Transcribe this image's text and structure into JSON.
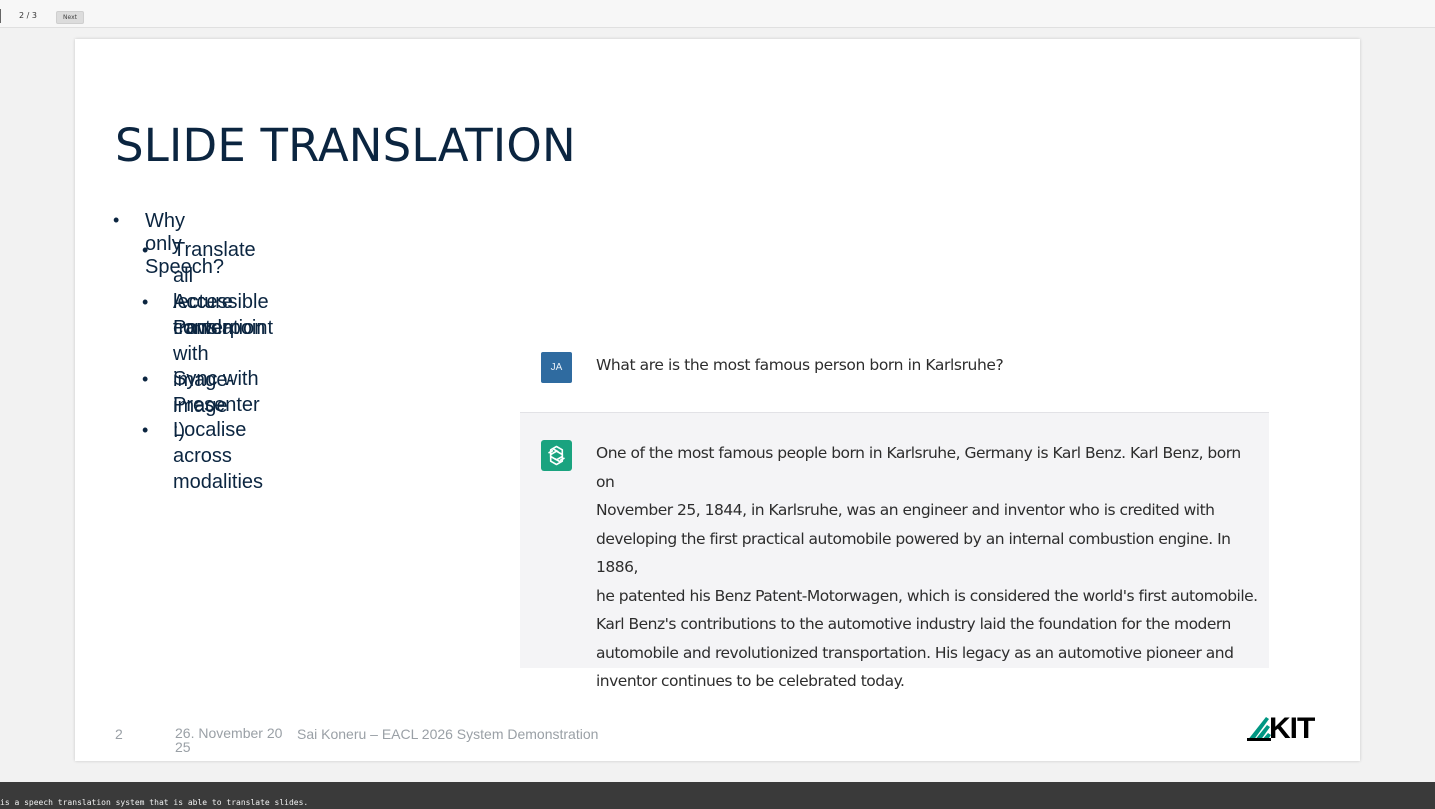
{
  "viewer": {
    "page_indicator": "2 / 3",
    "next_label": "Next"
  },
  "slide": {
    "title": "SLIDE TRANSLATION",
    "bullet_main": "Why only Speech?",
    "sub_bullets": [
      "Translate all lecture content",
      "Accessible Powerpoint with image-image",
      "translation",
      "Sync with Presenter :)",
      "Localise across modalities"
    ],
    "chat": {
      "user_avatar": "JA",
      "user_message": "What are is the most famous person born in Karlsruhe?",
      "assistant_icon": "chatgpt-logo-icon",
      "assistant_lines": [
        "One of the most famous people born in Karlsruhe, Germany is Karl Benz. Karl Benz, born on",
        "November 25, 1844, in Karlsruhe, was an engineer and inventor who is credited with",
        "developing the first practical automobile powered by an internal combustion engine. In 1886,",
        "he patented his Benz Patent-Motorwagen, which is considered the world's first automobile.",
        "Karl Benz's contributions to the automotive industry laid the foundation for the modern",
        "automobile and revolutionized transportation. His legacy as an automotive pioneer and",
        "inventor continues to be celebrated today."
      ]
    },
    "footer": {
      "page_number": "2",
      "date": "26. November 20\n25",
      "author": "Sai Koneru – EACL 2026 System Demonstration"
    },
    "logo_text": "KIT"
  },
  "caption": "is a speech translation system that is able to translate slides.",
  "colors": {
    "title": "#0b2540",
    "user_avatar_bg": "#2f6ba0",
    "assistant_icon_bg": "#1aa37f",
    "caption_bar": "#3a3a3a"
  }
}
